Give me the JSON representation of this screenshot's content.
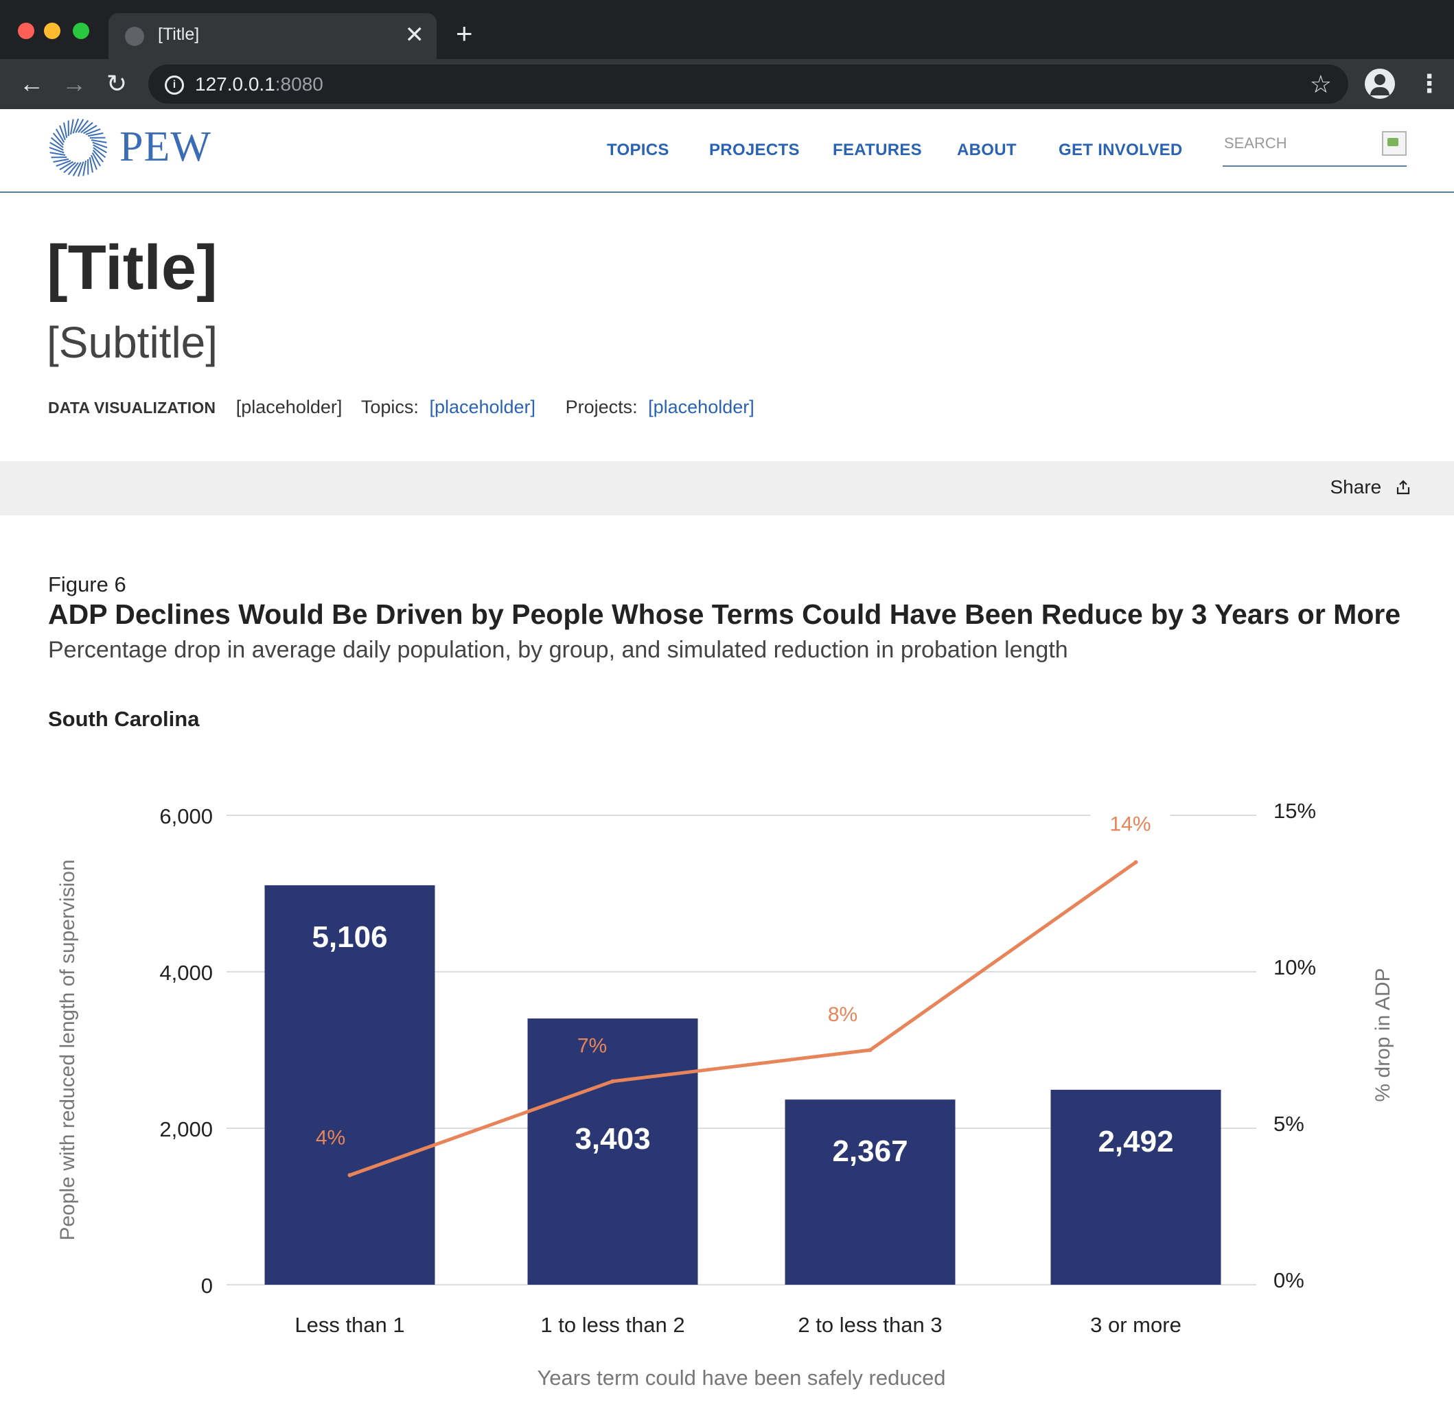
{
  "browser": {
    "tab_title": "[Title]",
    "url_host": "127.0.0.1",
    "url_port": ":8080",
    "new_tab_glyph": "+",
    "close_glyph": "✕"
  },
  "site": {
    "logo_text": "PEW",
    "nav": [
      "TOPICS",
      "PROJECTS",
      "FEATURES",
      "ABOUT",
      "GET INVOLVED"
    ],
    "search_placeholder": "SEARCH"
  },
  "page": {
    "title": "[Title]",
    "subtitle": "[Subtitle]",
    "meta": {
      "type": "DATA VISUALIZATION",
      "date": "[placeholder]",
      "topics_label": "Topics:",
      "topics_value": "[placeholder]",
      "projects_label": "Projects:",
      "projects_value": "[placeholder]"
    },
    "share_label": "Share"
  },
  "figure": {
    "label": "Figure 6",
    "title": "ADP Declines Would Be Driven by People Whose Terms Could Have Been Reduce by 3 Years or More",
    "subtitle": "Percentage drop in average daily population, by group, and simulated reduction in probation length",
    "group": "South Carolina"
  },
  "colors": {
    "bar": "#2b3773",
    "line": "#e8845a",
    "link": "#2a63b3",
    "grid": "#dddddd"
  },
  "chart_data": {
    "type": "bar",
    "categories": [
      "Less than 1",
      "1 to less than 2",
      "2 to less than 3",
      "3 or more"
    ],
    "series": [
      {
        "type": "bar",
        "axis": "left",
        "values": [
          5106,
          3403,
          2367,
          2492
        ],
        "labels": [
          "5,106",
          "3,403",
          "2,367",
          "2,492"
        ]
      },
      {
        "type": "line",
        "axis": "right",
        "values": [
          3.5,
          6.5,
          7.5,
          13.5
        ],
        "labels": [
          "4%",
          "7%",
          "8%",
          "14%"
        ]
      }
    ],
    "xlabel": "Years term could have been safely reduced",
    "ylabel": "People with reduced length of supervision",
    "y2label": "% drop in ADP",
    "ylim": [
      0,
      6000
    ],
    "y2lim": [
      0,
      15
    ],
    "yticks": [
      "0",
      "2,000",
      "4,000",
      "6,000"
    ],
    "y2ticks": [
      "0%",
      "5%",
      "10%",
      "15%"
    ],
    "grid": true
  }
}
